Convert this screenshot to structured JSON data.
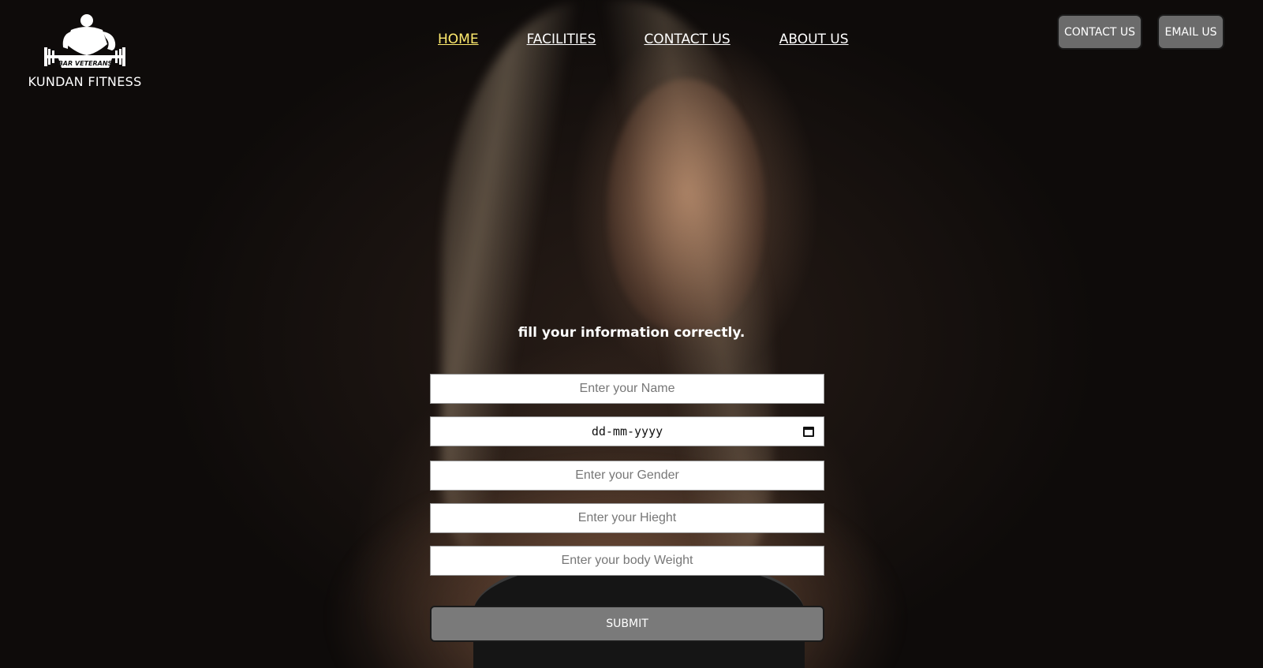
{
  "brand": {
    "logo_text": "BAR VETERANS",
    "name": "KUNDAN FITNESS"
  },
  "nav": {
    "items": [
      {
        "label": "HOME",
        "active": true
      },
      {
        "label": "FACILITIES",
        "active": false
      },
      {
        "label": "CONTACT US",
        "active": false
      },
      {
        "label": "ABOUT US",
        "active": false
      }
    ],
    "active_color": "#ffeb6e"
  },
  "header_buttons": {
    "contact_label": "CONTACT US",
    "email_label": "EMAIL US"
  },
  "form": {
    "title": "fill your information correctly.",
    "name_placeholder": "Enter your Name",
    "dob_placeholder": "dd-mm-yyyy",
    "gender_placeholder": "Enter your Gender",
    "height_placeholder": "Enter your Hieght",
    "weight_placeholder": "Enter your body Weight",
    "submit_label": "SUBMIT"
  }
}
